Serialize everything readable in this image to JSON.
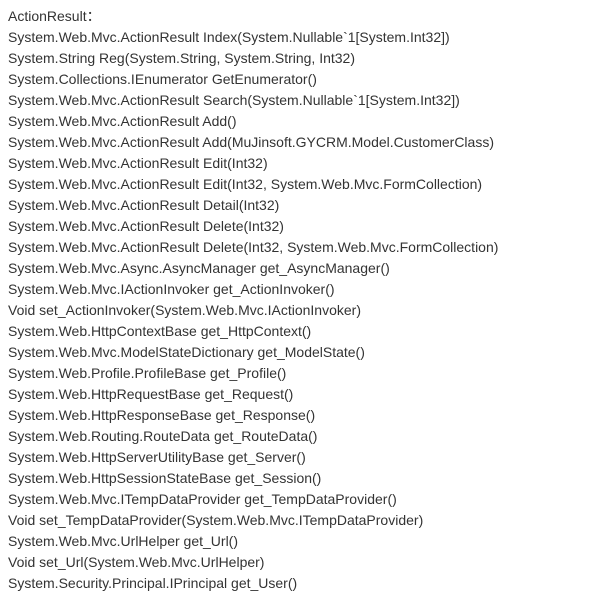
{
  "header": "ActionResult：",
  "lines": [
    "System.Web.Mvc.ActionResult Index(System.Nullable`1[System.Int32])",
    "System.String Reg(System.String, System.String, Int32)",
    "System.Collections.IEnumerator GetEnumerator()",
    "System.Web.Mvc.ActionResult Search(System.Nullable`1[System.Int32])",
    "System.Web.Mvc.ActionResult Add()",
    "System.Web.Mvc.ActionResult Add(MuJinsoft.GYCRM.Model.CustomerClass)",
    "System.Web.Mvc.ActionResult Edit(Int32)",
    "System.Web.Mvc.ActionResult Edit(Int32, System.Web.Mvc.FormCollection)",
    "System.Web.Mvc.ActionResult Detail(Int32)",
    "System.Web.Mvc.ActionResult Delete(Int32)",
    "System.Web.Mvc.ActionResult Delete(Int32, System.Web.Mvc.FormCollection)",
    "System.Web.Mvc.Async.AsyncManager get_AsyncManager()",
    "System.Web.Mvc.IActionInvoker get_ActionInvoker()",
    "Void set_ActionInvoker(System.Web.Mvc.IActionInvoker)",
    "System.Web.HttpContextBase get_HttpContext()",
    "System.Web.Mvc.ModelStateDictionary get_ModelState()",
    "System.Web.Profile.ProfileBase get_Profile()",
    "System.Web.HttpRequestBase get_Request()",
    "System.Web.HttpResponseBase get_Response()",
    "System.Web.Routing.RouteData get_RouteData()",
    "System.Web.HttpServerUtilityBase get_Server()",
    "System.Web.HttpSessionStateBase get_Session()",
    "System.Web.Mvc.ITempDataProvider get_TempDataProvider()",
    "Void set_TempDataProvider(System.Web.Mvc.ITempDataProvider)",
    "System.Web.Mvc.UrlHelper get_Url()",
    "Void set_Url(System.Web.Mvc.UrlHelper)",
    "System.Security.Principal.IPrincipal get_User()"
  ]
}
